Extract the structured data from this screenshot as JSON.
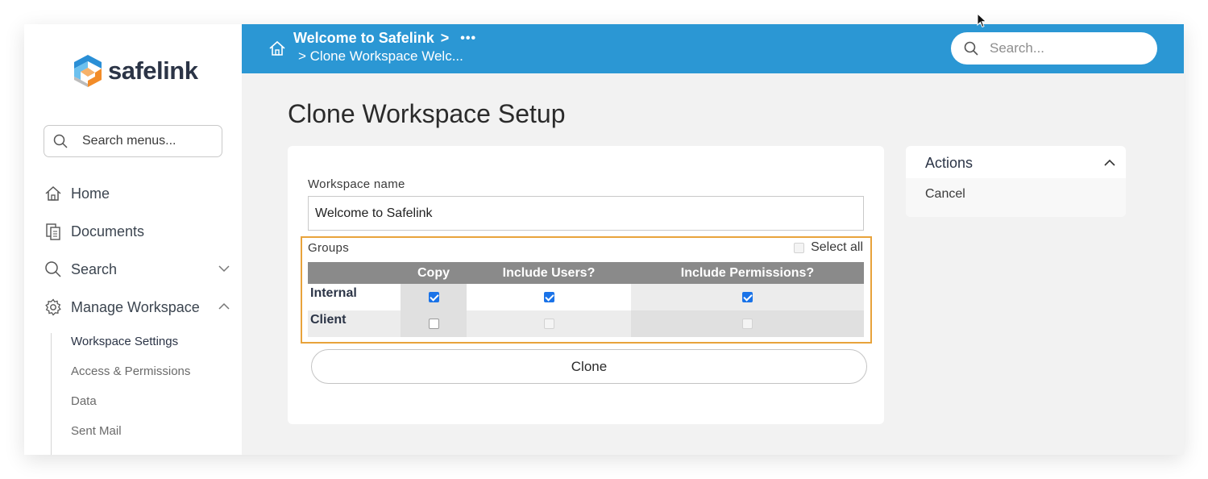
{
  "sidebar": {
    "logo_text": "safelink",
    "search_placeholder": "Search menus...",
    "items": [
      {
        "label": "Home",
        "icon": "home-icon"
      },
      {
        "label": "Documents",
        "icon": "documents-icon"
      },
      {
        "label": "Search",
        "icon": "search-icon",
        "chevron": "down"
      },
      {
        "label": "Manage Workspace",
        "icon": "gear-icon",
        "chevron": "up"
      }
    ],
    "sub_items": [
      {
        "label": "Workspace Settings",
        "active": true
      },
      {
        "label": "Access & Permissions",
        "active": false
      },
      {
        "label": "Data",
        "active": false
      },
      {
        "label": "Sent Mail",
        "active": false
      }
    ]
  },
  "header": {
    "breadcrumb_1": "Welcome to Safelink",
    "breadcrumb_sep": ">",
    "breadcrumb_more": "•••",
    "breadcrumb_2": "> Clone Workspace Welc...",
    "search_placeholder": "Search..."
  },
  "main": {
    "title": "Clone Workspace Setup",
    "workspace_name_label": "Workspace name",
    "workspace_name_value": "Welcome to Safelink",
    "groups_label": "Groups",
    "select_all_label": "Select all",
    "select_all_checked": false,
    "columns": [
      "",
      "Copy",
      "Include Users?",
      "Include Permissions?"
    ],
    "rows": [
      {
        "name": "Internal",
        "copy": true,
        "include_users": true,
        "include_permissions": true,
        "disabled": false
      },
      {
        "name": "Client",
        "copy": false,
        "include_users": false,
        "include_permissions": false,
        "disabled": true
      }
    ],
    "clone_button": "Clone"
  },
  "actions": {
    "title": "Actions",
    "cancel": "Cancel"
  },
  "colors": {
    "header_blue": "#2b97d4",
    "highlight_orange": "#e8a33b",
    "table_header_gray": "#8a8a8a",
    "checkbox_blue": "#1a73e8"
  }
}
